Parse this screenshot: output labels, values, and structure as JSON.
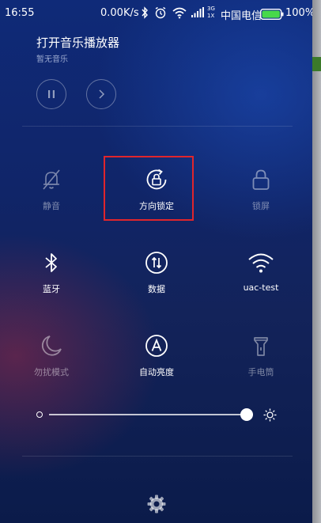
{
  "status_bar": {
    "time": "16:55",
    "network_speed": "0.00K/s",
    "signal_labels": [
      "3G",
      "1X"
    ],
    "carrier": "中国电信",
    "battery_percent": "100%",
    "battery_color": "#47d94a",
    "icons": [
      "bluetooth-icon",
      "alarm-icon",
      "wifi-icon",
      "signal-icon",
      "battery-icon"
    ]
  },
  "media": {
    "title": "打开音乐播放器",
    "subtitle": "暂无音乐",
    "controls": [
      "pause-icon",
      "next-icon"
    ]
  },
  "toggles": [
    {
      "label": "静音",
      "icon": "mute-bell-icon",
      "active": false
    },
    {
      "label": "方向锁定",
      "icon": "rotation-lock-icon",
      "active": true,
      "highlighted": true
    },
    {
      "label": "锁屏",
      "icon": "lock-icon",
      "active": false
    },
    {
      "label": "蓝牙",
      "icon": "bluetooth-icon",
      "active": true
    },
    {
      "label": "数据",
      "icon": "mobile-data-icon",
      "active": true
    },
    {
      "label": "uac-test",
      "icon": "wifi-icon",
      "active": true
    },
    {
      "label": "勿扰模式",
      "icon": "moon-icon",
      "active": false
    },
    {
      "label": "自动亮度",
      "icon": "auto-brightness-icon",
      "active": true
    },
    {
      "label": "手电筒",
      "icon": "flashlight-icon",
      "active": false
    }
  ],
  "brightness": {
    "level": 0.97
  },
  "settings": {
    "icon": "gear-icon"
  },
  "colors": {
    "highlight_border": "#e0252c"
  }
}
